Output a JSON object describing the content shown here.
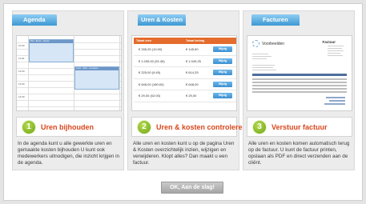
{
  "panels": [
    {
      "tab": "Agenda",
      "number": "1",
      "title": "Uren bijhouden",
      "description": "In de agenda kunt u alle gewerkte uren en gemaakte kosten bijhouden U kunt ook medewerkers uitnodigen, die inzicht krijgen in de agenda.",
      "agenda": {
        "times": [
          "10:00",
          "11:00",
          "12:00",
          "13:00",
          "14:00"
        ],
        "event1": "Piet - Bouw - Jansen",
        "event2": "Joost - Web - Lucassen"
      }
    },
    {
      "tab": "Uren & Kosten",
      "number": "2",
      "title": "Uren & kosten controleren",
      "description": "Alle uren en kosten kunt u op de pagina Uren & Kosten overzichtelijk inzien, wijzigen en verwijderen. Klopt alles? Dan maakt u een factuur.",
      "table": {
        "col1": "Totaal uren",
        "col2": "Totaal bedrag",
        "rows": [
          {
            "uren": "€ 335,25 (10:00)",
            "bedrag": "€ 145,50",
            "button": "Wijzig"
          },
          {
            "uren": "€ 1.035,00 (51:45)",
            "bedrag": "€ 1.049,25",
            "button": "Wijzig"
          },
          {
            "uren": "€ 225,00 (0:45)",
            "bedrag": "€ 614,25",
            "button": "Wijzig"
          },
          {
            "uren": "€ 648,00 (180:00)",
            "bedrag": "€ 648,00",
            "button": "Wijzig"
          },
          {
            "uren": "€ 29,00 (02:00)",
            "bedrag": "€ 29,00",
            "button": "Wijzig"
          }
        ]
      }
    },
    {
      "tab": "Facturen",
      "number": "3",
      "title": "Verstuur factuur",
      "description": "Alle uren en kosten komen automatisch terug op de factuur. U kunt de factuur printen, opslaan als PDF en direct verzenden aan de cliënt.",
      "invoice": {
        "brand": "Voorbeelden",
        "heading": "Factuur"
      }
    }
  ],
  "ok_button": "OK, Aan de slag!",
  "colors": {
    "tab_blue": "#3c98d3",
    "accent_orange": "#d9461c",
    "badge_green": "#6ba412",
    "table_header": "#e46c2c"
  }
}
